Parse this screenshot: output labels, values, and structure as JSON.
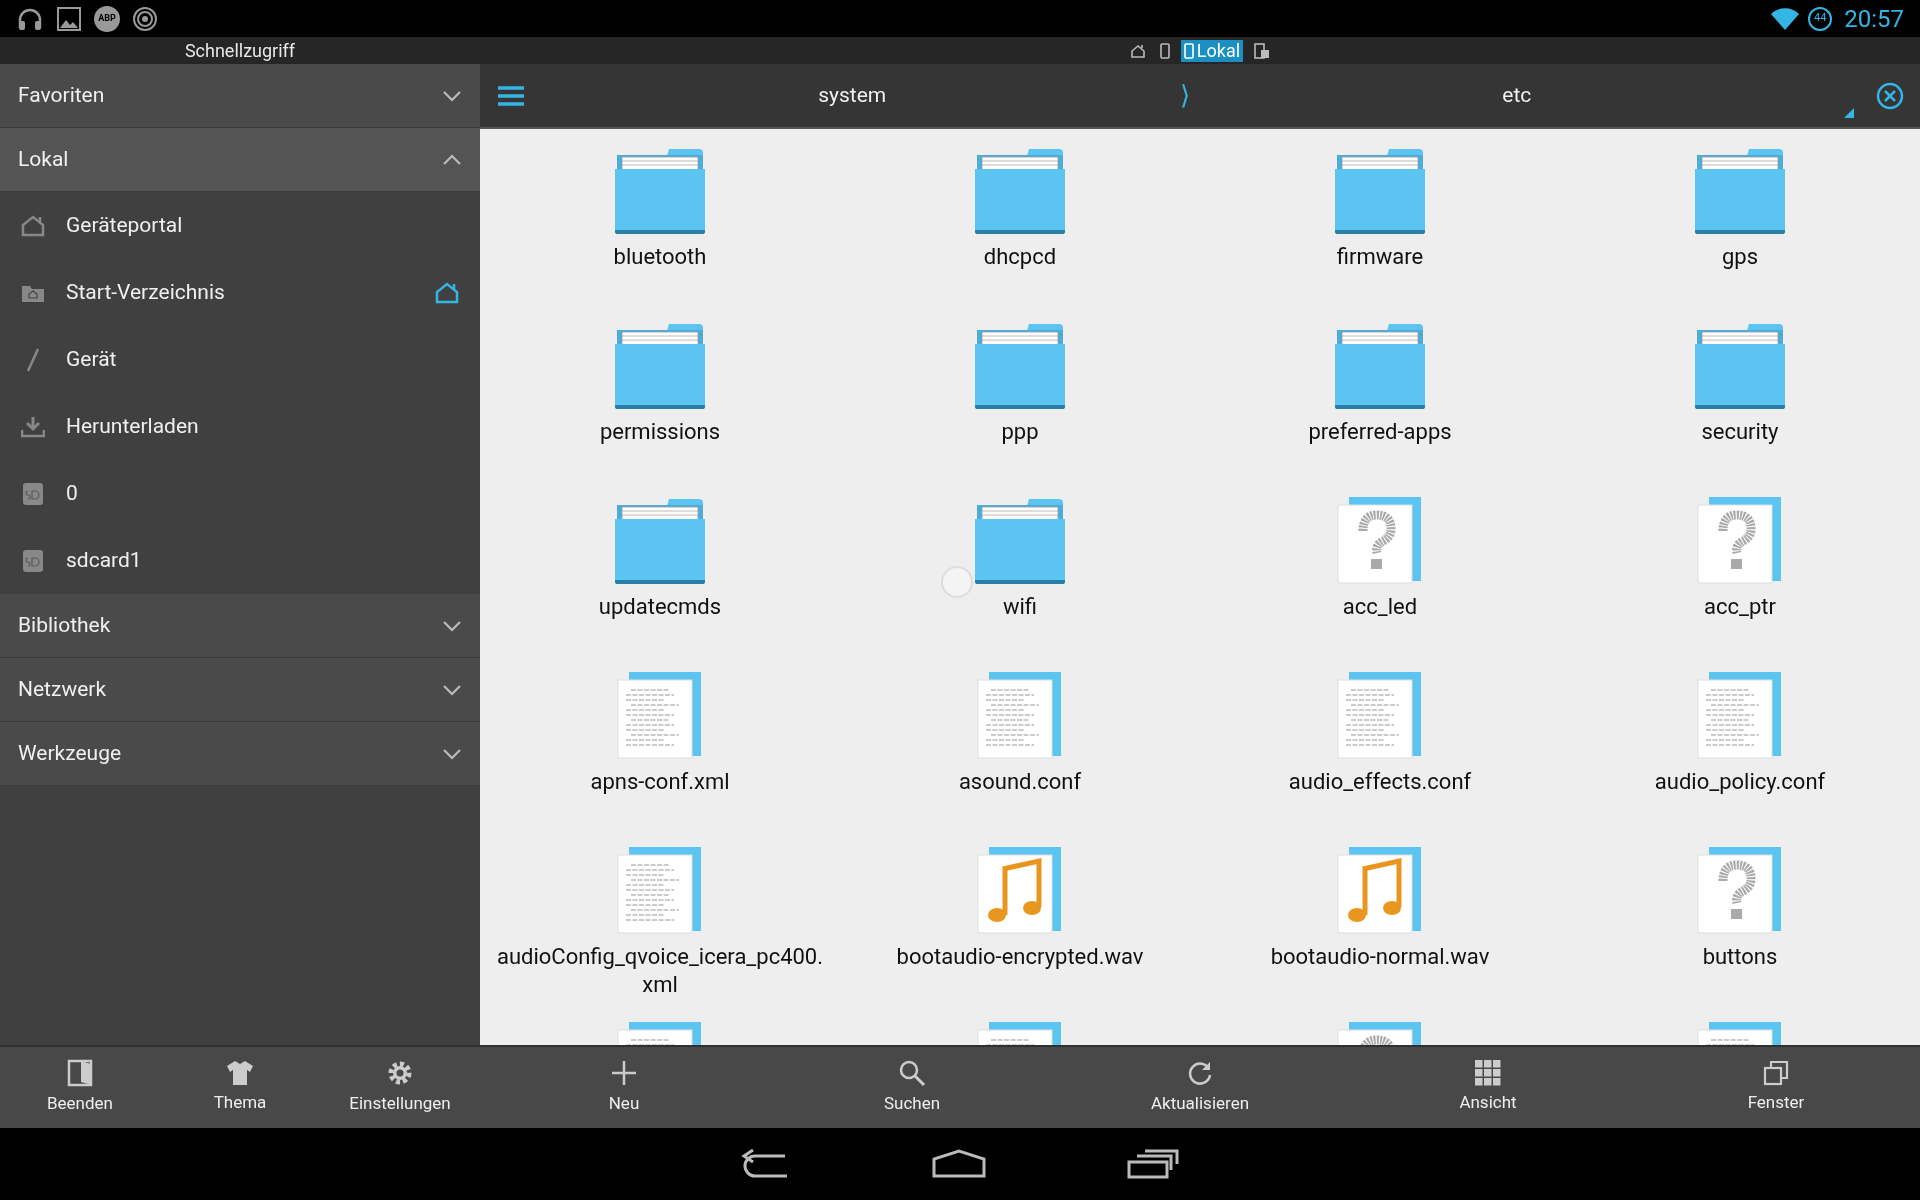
{
  "status_bar": {
    "left_icons": [
      {
        "kind": "headphones"
      },
      {
        "kind": "image"
      },
      {
        "kind": "abp",
        "label": "ABP"
      },
      {
        "kind": "signal"
      }
    ],
    "battery": "44",
    "time": "20:57"
  },
  "sidebar": {
    "title": "Schnellzugriff",
    "sections": [
      {
        "label": "Favoriten",
        "expanded": false
      },
      {
        "label": "Lokal",
        "expanded": true,
        "items": [
          {
            "label": "Geräteportal",
            "kind": "portal",
            "default": false
          },
          {
            "label": "Start-Verzeichnis",
            "kind": "homefolder",
            "default": true
          },
          {
            "label": "Gerät",
            "kind": "root",
            "default": false
          },
          {
            "label": "Herunterladen",
            "kind": "download",
            "default": false
          },
          {
            "label": "0",
            "kind": "sd",
            "default": false
          },
          {
            "label": "sdcard1",
            "kind": "sd",
            "default": false
          }
        ]
      },
      {
        "label": "Bibliothek",
        "expanded": false
      },
      {
        "label": "Netzwerk",
        "expanded": false
      },
      {
        "label": "Werkzeuge",
        "expanded": false
      }
    ],
    "toolbar": [
      {
        "label": "Beenden",
        "kind": "exit"
      },
      {
        "label": "Thema",
        "kind": "shirt"
      },
      {
        "label": "Einstellungen",
        "kind": "gear"
      }
    ]
  },
  "location_tabs": [
    {
      "kind": "home",
      "selected": false
    },
    {
      "kind": "phone",
      "selected": false
    },
    {
      "kind": "phone",
      "label": "Lokal",
      "selected": true
    },
    {
      "kind": "network",
      "selected": false
    }
  ],
  "path": {
    "segments": [
      "system",
      "etc"
    ],
    "separator": "⟩"
  },
  "files": [
    {
      "name": "bluetooth",
      "kind": "folder"
    },
    {
      "name": "dhcpcd",
      "kind": "folder"
    },
    {
      "name": "firmware",
      "kind": "folder"
    },
    {
      "name": "gps",
      "kind": "folder"
    },
    {
      "name": "permissions",
      "kind": "folder"
    },
    {
      "name": "ppp",
      "kind": "folder"
    },
    {
      "name": "preferred-apps",
      "kind": "folder"
    },
    {
      "name": "security",
      "kind": "folder"
    },
    {
      "name": "updatecmds",
      "kind": "folder"
    },
    {
      "name": "wifi",
      "kind": "folder"
    },
    {
      "name": "acc_led",
      "kind": "unknown"
    },
    {
      "name": "acc_ptr",
      "kind": "unknown"
    },
    {
      "name": "apns-conf.xml",
      "kind": "text"
    },
    {
      "name": "asound.conf",
      "kind": "text"
    },
    {
      "name": "audio_effects.conf",
      "kind": "text"
    },
    {
      "name": "audio_policy.conf",
      "kind": "text"
    },
    {
      "name": "audioConfig_qvoice_icera_pc400.xml",
      "kind": "text"
    },
    {
      "name": "bootaudio-encrypted.wav",
      "kind": "audio"
    },
    {
      "name": "bootaudio-normal.wav",
      "kind": "audio"
    },
    {
      "name": "buttons",
      "kind": "unknown"
    },
    {
      "kind": "text"
    },
    {
      "kind": "text"
    },
    {
      "kind": "unknown"
    },
    {
      "kind": "text"
    }
  ],
  "toolbar": [
    {
      "label": "Neu",
      "kind": "plus"
    },
    {
      "label": "Suchen",
      "kind": "search"
    },
    {
      "label": "Aktualisieren",
      "kind": "refresh"
    },
    {
      "label": "Ansicht",
      "kind": "grid"
    },
    {
      "label": "Fenster",
      "kind": "windows"
    }
  ]
}
